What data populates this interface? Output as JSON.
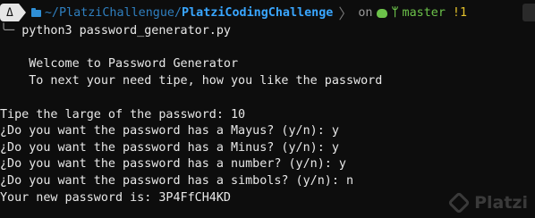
{
  "prompt": {
    "os_glyph": "Δ",
    "path_dim": "~/PlatziChallengue/",
    "path_bold": "PlatziCodingChallenge",
    "on_label": "on",
    "branch": "master",
    "dirty": "!1"
  },
  "command": {
    "prefix": "╰─ ",
    "text": "python3 password_generator.py"
  },
  "output": {
    "welcome": "    Welcome to Password Generator",
    "instructions": "    To next your need tipe, how you like the password",
    "q_length": "Tipe the large of the password: 10",
    "q_mayus": "¿Do you want the password has a Mayus? (y/n): y",
    "q_minus": "¿Do you want the password has a Minus? (y/n): y",
    "q_number": "¿Do you want the password has a number? (y/n): y",
    "q_simbols": "¿Do you want the password has a simbols? (y/n): n",
    "result": "Your new password is: 3P4FfCH4KD"
  },
  "watermark": {
    "text": "Platzi"
  }
}
